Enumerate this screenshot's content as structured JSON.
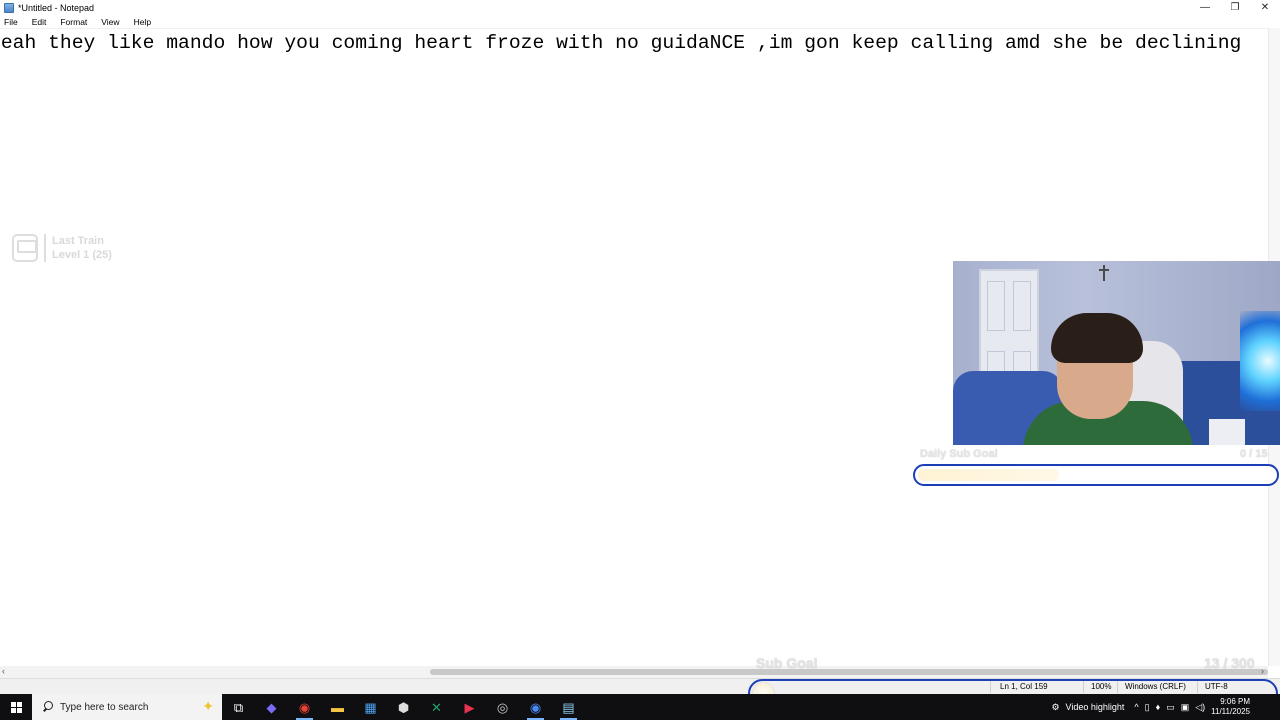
{
  "window": {
    "title": "*Untitled - Notepad",
    "minimize_glyph": "—",
    "maximize_glyph": "❐",
    "close_glyph": "✕"
  },
  "menu": {
    "items": [
      "File",
      "Edit",
      "Format",
      "View",
      "Help"
    ]
  },
  "editor": {
    "line1": "yeah they like mando how you coming heart froze with no guidaNCE ,im gon keep calling amd she be declining"
  },
  "scrollbar": {
    "left_arrow": "‹",
    "right_arrow": "›"
  },
  "statusbar": {
    "position": "Ln 1, Col 159",
    "zoom": "100%",
    "line_ending": "Windows (CRLF)",
    "encoding": "UTF-8"
  },
  "overlay": {
    "train_title": "Last Train",
    "train_level": "Level 1  (25)",
    "daily_goal_label": "Daily Sub Goal",
    "daily_goal_count": "0 / 15",
    "daily_goal_progress": 0.39,
    "sub_goal_label": "Sub Goal",
    "sub_goal_count": "13 / 300",
    "sub_goal_progress": 0.043
  },
  "taskbar": {
    "search_placeholder": "Type here to search",
    "video_highlight": "Video highlight",
    "time": "9:06 PM",
    "date": "11/11/2025",
    "icons": [
      "task-view-icon",
      "copilot-icon",
      "chrome-icon",
      "file-explorer-icon",
      "store-icon",
      "app-icon",
      "excel-icon",
      "media-icon",
      "steam-icon",
      "chrome-profile-icon",
      "notepad-icon"
    ]
  },
  "colors": {
    "goal_border": "#1c3fb8",
    "taskbar_bg": "#0f0f12"
  }
}
